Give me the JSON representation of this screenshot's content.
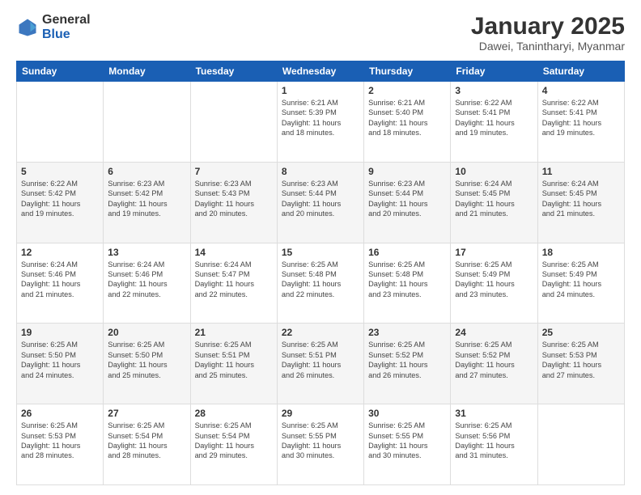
{
  "logo": {
    "general": "General",
    "blue": "Blue"
  },
  "title": "January 2025",
  "location": "Dawei, Tanintharyi, Myanmar",
  "days_header": [
    "Sunday",
    "Monday",
    "Tuesday",
    "Wednesday",
    "Thursday",
    "Friday",
    "Saturday"
  ],
  "weeks": [
    [
      {
        "day": "",
        "info": ""
      },
      {
        "day": "",
        "info": ""
      },
      {
        "day": "",
        "info": ""
      },
      {
        "day": "1",
        "info": "Sunrise: 6:21 AM\nSunset: 5:39 PM\nDaylight: 11 hours\nand 18 minutes."
      },
      {
        "day": "2",
        "info": "Sunrise: 6:21 AM\nSunset: 5:40 PM\nDaylight: 11 hours\nand 18 minutes."
      },
      {
        "day": "3",
        "info": "Sunrise: 6:22 AM\nSunset: 5:41 PM\nDaylight: 11 hours\nand 19 minutes."
      },
      {
        "day": "4",
        "info": "Sunrise: 6:22 AM\nSunset: 5:41 PM\nDaylight: 11 hours\nand 19 minutes."
      }
    ],
    [
      {
        "day": "5",
        "info": "Sunrise: 6:22 AM\nSunset: 5:42 PM\nDaylight: 11 hours\nand 19 minutes."
      },
      {
        "day": "6",
        "info": "Sunrise: 6:23 AM\nSunset: 5:42 PM\nDaylight: 11 hours\nand 19 minutes."
      },
      {
        "day": "7",
        "info": "Sunrise: 6:23 AM\nSunset: 5:43 PM\nDaylight: 11 hours\nand 20 minutes."
      },
      {
        "day": "8",
        "info": "Sunrise: 6:23 AM\nSunset: 5:44 PM\nDaylight: 11 hours\nand 20 minutes."
      },
      {
        "day": "9",
        "info": "Sunrise: 6:23 AM\nSunset: 5:44 PM\nDaylight: 11 hours\nand 20 minutes."
      },
      {
        "day": "10",
        "info": "Sunrise: 6:24 AM\nSunset: 5:45 PM\nDaylight: 11 hours\nand 21 minutes."
      },
      {
        "day": "11",
        "info": "Sunrise: 6:24 AM\nSunset: 5:45 PM\nDaylight: 11 hours\nand 21 minutes."
      }
    ],
    [
      {
        "day": "12",
        "info": "Sunrise: 6:24 AM\nSunset: 5:46 PM\nDaylight: 11 hours\nand 21 minutes."
      },
      {
        "day": "13",
        "info": "Sunrise: 6:24 AM\nSunset: 5:46 PM\nDaylight: 11 hours\nand 22 minutes."
      },
      {
        "day": "14",
        "info": "Sunrise: 6:24 AM\nSunset: 5:47 PM\nDaylight: 11 hours\nand 22 minutes."
      },
      {
        "day": "15",
        "info": "Sunrise: 6:25 AM\nSunset: 5:48 PM\nDaylight: 11 hours\nand 22 minutes."
      },
      {
        "day": "16",
        "info": "Sunrise: 6:25 AM\nSunset: 5:48 PM\nDaylight: 11 hours\nand 23 minutes."
      },
      {
        "day": "17",
        "info": "Sunrise: 6:25 AM\nSunset: 5:49 PM\nDaylight: 11 hours\nand 23 minutes."
      },
      {
        "day": "18",
        "info": "Sunrise: 6:25 AM\nSunset: 5:49 PM\nDaylight: 11 hours\nand 24 minutes."
      }
    ],
    [
      {
        "day": "19",
        "info": "Sunrise: 6:25 AM\nSunset: 5:50 PM\nDaylight: 11 hours\nand 24 minutes."
      },
      {
        "day": "20",
        "info": "Sunrise: 6:25 AM\nSunset: 5:50 PM\nDaylight: 11 hours\nand 25 minutes."
      },
      {
        "day": "21",
        "info": "Sunrise: 6:25 AM\nSunset: 5:51 PM\nDaylight: 11 hours\nand 25 minutes."
      },
      {
        "day": "22",
        "info": "Sunrise: 6:25 AM\nSunset: 5:51 PM\nDaylight: 11 hours\nand 26 minutes."
      },
      {
        "day": "23",
        "info": "Sunrise: 6:25 AM\nSunset: 5:52 PM\nDaylight: 11 hours\nand 26 minutes."
      },
      {
        "day": "24",
        "info": "Sunrise: 6:25 AM\nSunset: 5:52 PM\nDaylight: 11 hours\nand 27 minutes."
      },
      {
        "day": "25",
        "info": "Sunrise: 6:25 AM\nSunset: 5:53 PM\nDaylight: 11 hours\nand 27 minutes."
      }
    ],
    [
      {
        "day": "26",
        "info": "Sunrise: 6:25 AM\nSunset: 5:53 PM\nDaylight: 11 hours\nand 28 minutes."
      },
      {
        "day": "27",
        "info": "Sunrise: 6:25 AM\nSunset: 5:54 PM\nDaylight: 11 hours\nand 28 minutes."
      },
      {
        "day": "28",
        "info": "Sunrise: 6:25 AM\nSunset: 5:54 PM\nDaylight: 11 hours\nand 29 minutes."
      },
      {
        "day": "29",
        "info": "Sunrise: 6:25 AM\nSunset: 5:55 PM\nDaylight: 11 hours\nand 30 minutes."
      },
      {
        "day": "30",
        "info": "Sunrise: 6:25 AM\nSunset: 5:55 PM\nDaylight: 11 hours\nand 30 minutes."
      },
      {
        "day": "31",
        "info": "Sunrise: 6:25 AM\nSunset: 5:56 PM\nDaylight: 11 hours\nand 31 minutes."
      },
      {
        "day": "",
        "info": ""
      }
    ]
  ]
}
